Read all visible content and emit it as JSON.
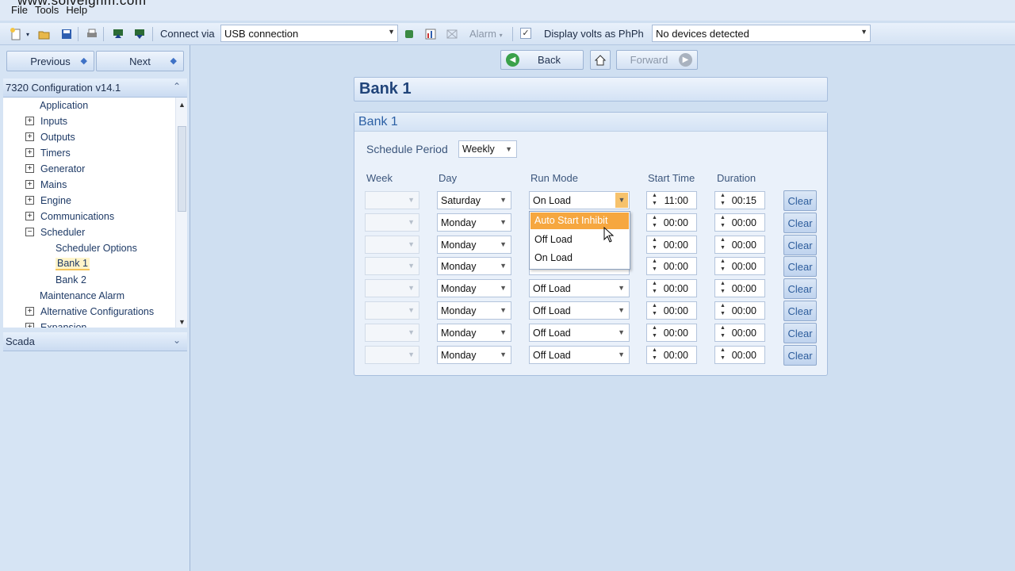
{
  "watermark": "www.solveignm.com",
  "menu": [
    "File",
    "Tools",
    "Help"
  ],
  "toolbar": {
    "connect_label": "Connect via",
    "connection": "USB connection",
    "alarm_label": "Alarm",
    "display_volts_label": "Display volts as PhPh",
    "display_volts_checked": true,
    "devices": "No devices detected"
  },
  "nav": {
    "previous": "Previous",
    "next": "Next"
  },
  "config_panel": {
    "title": "7320 Configuration v14.1",
    "tree": [
      {
        "label": "Application",
        "level": 1,
        "expander": ""
      },
      {
        "label": "Inputs",
        "level": 1,
        "expander": "+"
      },
      {
        "label": "Outputs",
        "level": 1,
        "expander": "+"
      },
      {
        "label": "Timers",
        "level": 1,
        "expander": "+"
      },
      {
        "label": "Generator",
        "level": 1,
        "expander": "+"
      },
      {
        "label": "Mains",
        "level": 1,
        "expander": "+"
      },
      {
        "label": "Engine",
        "level": 1,
        "expander": "+"
      },
      {
        "label": "Communications",
        "level": 1,
        "expander": "+"
      },
      {
        "label": "Scheduler",
        "level": 1,
        "expander": "−"
      },
      {
        "label": "Scheduler Options",
        "level": 2,
        "expander": ""
      },
      {
        "label": "Bank 1",
        "level": 2,
        "expander": "",
        "selected": true
      },
      {
        "label": "Bank 2",
        "level": 2,
        "expander": ""
      },
      {
        "label": "Maintenance Alarm",
        "level": 1,
        "expander": ""
      },
      {
        "label": "Alternative Configurations",
        "level": 1,
        "expander": "+"
      },
      {
        "label": "Expansion",
        "level": 1,
        "expander": "+"
      }
    ]
  },
  "scada_panel": {
    "title": "Scada"
  },
  "header_buttons": {
    "back": "Back",
    "forward": "Forward"
  },
  "page_title": "Bank 1",
  "bank": {
    "heading": "Bank 1",
    "schedule_period_label": "Schedule Period",
    "schedule_period": "Weekly",
    "columns": {
      "week": "Week",
      "day": "Day",
      "run_mode": "Run Mode",
      "start_time": "Start Time",
      "duration": "Duration"
    },
    "clear_label": "Clear",
    "rows": [
      {
        "week": "",
        "day": "Saturday",
        "run_mode": "On Load",
        "start_time": "11:00",
        "duration": "00:15"
      },
      {
        "week": "",
        "day": "Monday",
        "run_mode": "Off Load",
        "start_time": "00:00",
        "duration": "00:00"
      },
      {
        "week": "",
        "day": "Monday",
        "run_mode": "Off Load",
        "start_time": "00:00",
        "duration": "00:00"
      },
      {
        "week": "",
        "day": "Monday",
        "run_mode": "Off Load",
        "start_time": "00:00",
        "duration": "00:00"
      },
      {
        "week": "",
        "day": "Monday",
        "run_mode": "Off Load",
        "start_time": "00:00",
        "duration": "00:00"
      },
      {
        "week": "",
        "day": "Monday",
        "run_mode": "Off Load",
        "start_time": "00:00",
        "duration": "00:00"
      },
      {
        "week": "",
        "day": "Monday",
        "run_mode": "Off Load",
        "start_time": "00:00",
        "duration": "00:00"
      },
      {
        "week": "",
        "day": "Monday",
        "run_mode": "Off Load",
        "start_time": "00:00",
        "duration": "00:00"
      }
    ],
    "run_mode_options": [
      "Auto Start Inhibit",
      "Off Load",
      "On Load"
    ],
    "highlighted_option": 0
  }
}
